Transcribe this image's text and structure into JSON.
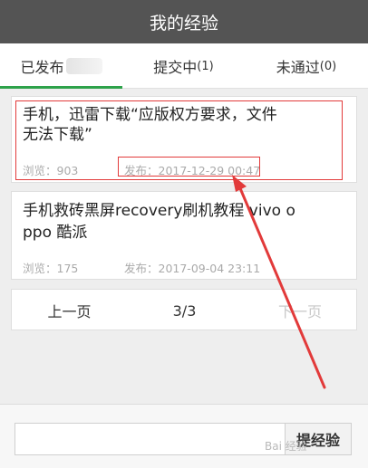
{
  "header": {
    "title": "我的经验"
  },
  "tabs": [
    {
      "label": "已发布",
      "count": ""
    },
    {
      "label": "提交中",
      "count": "(1)"
    },
    {
      "label": "未通过",
      "count": "(0)"
    }
  ],
  "articles": [
    {
      "title_line1": "手机，迅雷下载“应版权方要求，文件",
      "title_line2": "无法下载”",
      "views": "浏览：903",
      "published": "发布：2017-12-29 00:47"
    },
    {
      "title_line1": "手机救砖黑屏recovery刷机教程 vivo o",
      "title_line2": "ppo 酷派",
      "views": "浏览：175",
      "published": "发布：2017-09-04 23:11"
    }
  ],
  "pager": {
    "prev": "上一页",
    "current": "3/3",
    "next": "下一页"
  },
  "bottom": {
    "submit_label": "提经验",
    "input_value": ""
  },
  "watermark": "Bai 经验",
  "colors": {
    "header_bg": "#545454",
    "accent_green": "#2da24a",
    "annotation_red": "#e23a3a"
  }
}
